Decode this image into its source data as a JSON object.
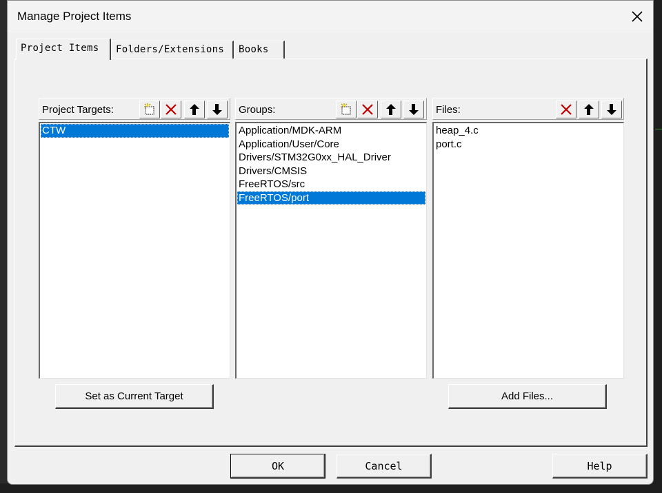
{
  "dialog": {
    "title": "Manage Project Items"
  },
  "tabs": [
    {
      "label": "Project Items"
    },
    {
      "label": "Folders/Extensions"
    },
    {
      "label": "Books"
    }
  ],
  "targets": {
    "label": "Project Targets:",
    "items": [
      "CTW"
    ],
    "selected_index": 0,
    "set_current_label": "Set as Current Target"
  },
  "groups": {
    "label": "Groups:",
    "items": [
      "Application/MDK-ARM",
      "Application/User/Core",
      "Drivers/STM32G0xx_HAL_Driver",
      "Drivers/CMSIS",
      "FreeRTOS/src",
      "FreeRTOS/port"
    ],
    "selected_index": 5
  },
  "files": {
    "label": "Files:",
    "items": [
      "heap_4.c",
      "port.c"
    ],
    "add_files_label": "Add Files..."
  },
  "footer": {
    "ok_label": "OK",
    "cancel_label": "Cancel",
    "help_label": "Help"
  },
  "icons": {
    "new": "new-item-icon",
    "delete": "delete-x-icon",
    "up": "move-up-arrow-icon",
    "down": "move-down-arrow-icon",
    "close": "close-icon"
  },
  "colors": {
    "selection": "#0078d7",
    "delete_red": "#c00000",
    "dialog_bg": "#f0f0f0"
  }
}
